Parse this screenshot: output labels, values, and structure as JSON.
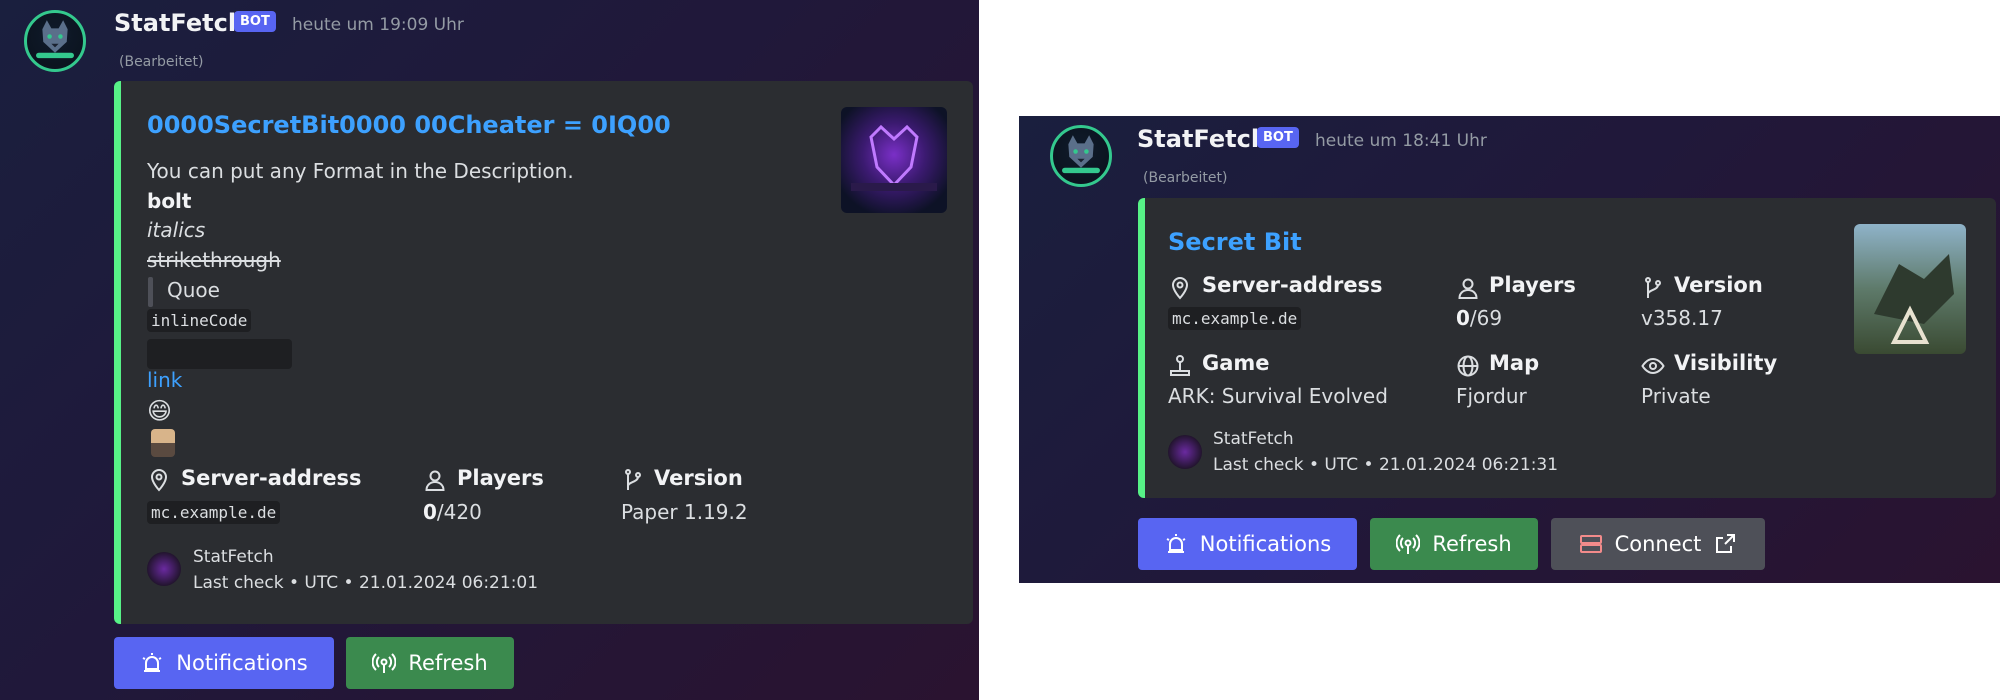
{
  "left_message": {
    "username": "StatFetch",
    "badge": "BOT",
    "timestamp": "heute um 19:09 Uhr",
    "edited": "(Bearbeitet)",
    "embed": {
      "accent_color": "#57f287",
      "title": "0000SecretBit0000 00Cheater = 0IQ00",
      "thumbnail_icon": "neon-logo-icon",
      "description": {
        "plain": "You can put any Format in the Description.",
        "bold": "bolt",
        "italic": "italics",
        "strike": "strikethrough",
        "quote": "Quoe",
        "inline_code": "inlineCode",
        "link": "link",
        "emoji": "😄"
      },
      "fields": [
        {
          "name": "Server-address",
          "value": "mc.example.de",
          "icon": "map-pin-icon"
        },
        {
          "name": "Players",
          "value_bold": "0",
          "value_rest": "/420",
          "icon": "person-icon"
        },
        {
          "name": "Version",
          "value": "Paper 1.19.2",
          "icon": "git-branch-icon"
        }
      ],
      "footer": {
        "name": "StatFetch",
        "text": "Last check • UTC • 21.01.2024 06:21:01"
      }
    },
    "buttons": {
      "notifications": "Notifications",
      "refresh": "Refresh"
    }
  },
  "right_message": {
    "username": "StatFetch",
    "badge": "BOT",
    "timestamp": "heute um 18:41 Uhr",
    "edited": "(Bearbeitet)",
    "embed": {
      "accent_color": "#57f287",
      "title": "Secret Bit",
      "thumbnail_icon": "ark-game-cover-icon",
      "fields": [
        {
          "name": "Server-address",
          "value": "mc.example.de",
          "icon": "map-pin-icon"
        },
        {
          "name": "Players",
          "value_bold": "0",
          "value_rest": "/69",
          "icon": "person-icon"
        },
        {
          "name": "Version",
          "value": "v358.17",
          "icon": "git-branch-icon"
        },
        {
          "name": "Game",
          "value": "ARK: Survival Evolved",
          "icon": "joystick-icon"
        },
        {
          "name": "Map",
          "value": "Fjordur",
          "icon": "globe-icon"
        },
        {
          "name": "Visibility",
          "value": "Private",
          "icon": "eye-icon"
        }
      ],
      "footer": {
        "name": "StatFetch",
        "text": "Last check • UTC • 21.01.2024 06:21:31"
      }
    },
    "buttons": {
      "notifications": "Notifications",
      "refresh": "Refresh",
      "connect": "Connect"
    }
  }
}
